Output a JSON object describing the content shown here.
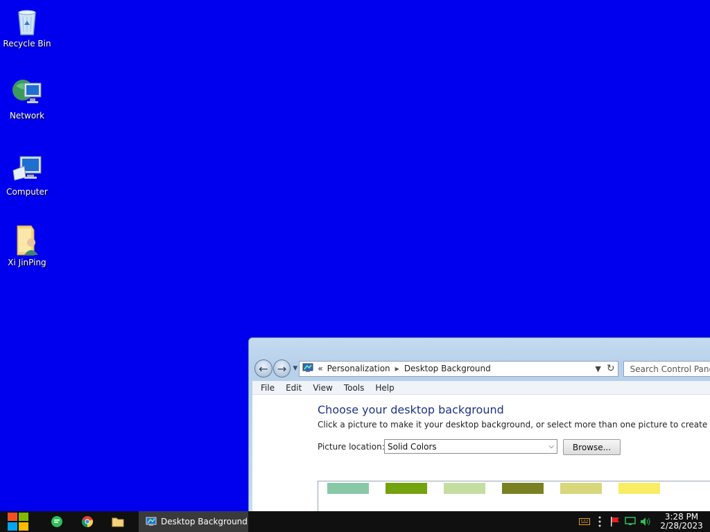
{
  "desktop": {
    "icons": [
      {
        "label": "Recycle Bin"
      },
      {
        "label": "Network"
      },
      {
        "label": "Computer"
      },
      {
        "label": "Xi JinPing"
      }
    ]
  },
  "window": {
    "breadcrumb_prefix": "«",
    "breadcrumb": [
      "Personalization",
      "Desktop Background"
    ],
    "search_placeholder": "Search Control Panel",
    "menu": [
      "File",
      "Edit",
      "View",
      "Tools",
      "Help"
    ],
    "title": "Choose your desktop background",
    "description": "Click a picture to make it your desktop background, or select more than one picture to create a slide show.",
    "picture_location_label": "Picture location:",
    "picture_location_value": "Solid Colors",
    "browse_label": "Browse...",
    "swatch_colors": [
      "#87c9a6",
      "#73a30e",
      "#c4dea1",
      "#7a8122",
      "#d8d77b",
      "#f8ed63"
    ]
  },
  "taskbar": {
    "active_task": "Desktop Background",
    "clock_time": "3:28 PM",
    "clock_date": "2/28/2023"
  },
  "colors": {
    "desktop_background": "#0000ee",
    "taskbar": "#101010"
  }
}
